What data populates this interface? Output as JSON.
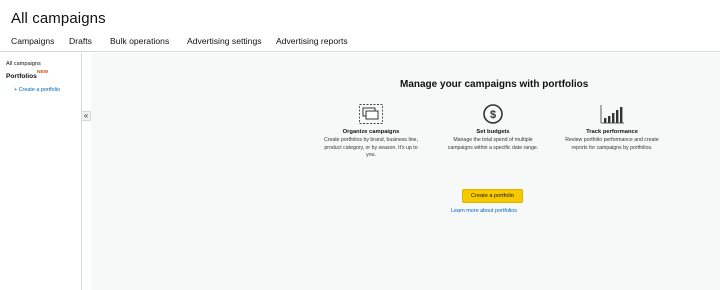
{
  "header": {
    "title": "All campaigns",
    "tabs": [
      {
        "label": "Campaigns"
      },
      {
        "label": "Drafts"
      },
      {
        "label": "Bulk operations"
      },
      {
        "label": "Advertising settings"
      },
      {
        "label": "Advertising reports"
      }
    ]
  },
  "sidebar": {
    "all_campaigns": "All campaigns",
    "portfolios_label": "Portfolios",
    "new_badge": "NEW",
    "create_link": "+ Create a portfolio",
    "collapse_glyph": "«"
  },
  "main": {
    "heading": "Manage your campaigns with portfolios",
    "features": [
      {
        "icon": "portfolio-stack-icon",
        "title": "Organize campaigns",
        "desc": "Create portfolios by brand, business line, product category, or by season. It's up to you."
      },
      {
        "icon": "dollar-circle-icon",
        "title": "Set budgets",
        "desc": "Manage the total spend of multiple campaigns within a specific date range."
      },
      {
        "icon": "bar-chart-icon",
        "title": "Track performance",
        "desc": "Review portfolio performance and create reports for campaigns by portfolios."
      }
    ],
    "cta_label": "Create a portfolio",
    "learn_more": "Learn more about portfolios"
  },
  "colors": {
    "accent_button": "#f7ca00",
    "link": "#0066c0",
    "new_badge": "#c45500",
    "main_bg": "#f7f8f8"
  }
}
